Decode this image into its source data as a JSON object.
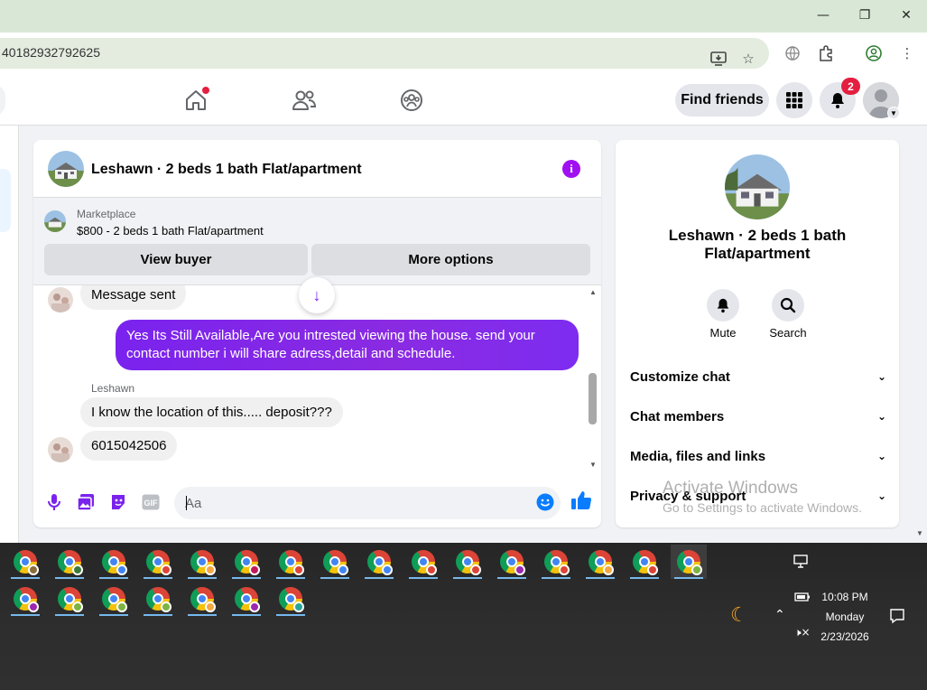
{
  "browser": {
    "url": "40182932792625",
    "window_controls": [
      "minimize",
      "restore",
      "close"
    ]
  },
  "nav": {
    "find_friends_label": "Find friends",
    "notification_count": "2",
    "icons": [
      "home-icon",
      "friends-icon",
      "groups-icon",
      "menu-grid-icon",
      "bell-icon",
      "account-avatar"
    ]
  },
  "chat": {
    "title": "Leshawn · 2 beds 1 bath Flat/apartment",
    "marketplace": {
      "label": "Marketplace",
      "price_line": "$800 - 2 beds 1 bath Flat/apartment",
      "view_buyer": "View buyer",
      "more_options": "More options"
    },
    "messages": [
      {
        "from": "Leshawn",
        "text": "Message sent"
      },
      {
        "from": "me",
        "text": "Yes Its Still Available,Are you intrested viewing the house. send your contact number i will share adress,detail and schedule."
      },
      {
        "from": "Leshawn",
        "sender_label": "Leshawn",
        "text": "I know the location of this..... deposit???"
      },
      {
        "from": "Leshawn",
        "text": "6015042506"
      }
    ],
    "composer_placeholder": "Aa",
    "colors": {
      "outgoing": "#7a23ee",
      "accent": "#a010f0"
    }
  },
  "details": {
    "name": "Leshawn · 2 beds 1 bath Flat/apartment",
    "actions": [
      {
        "label": "Mute"
      },
      {
        "label": "Search"
      }
    ],
    "sections": [
      {
        "label": "Customize chat"
      },
      {
        "label": "Chat members"
      },
      {
        "label": "Media, files and links"
      },
      {
        "label": "Privacy & support"
      }
    ]
  },
  "watermark": {
    "line1": "Activate Windows",
    "line2": "Go to Settings to activate Windows."
  },
  "taskbar": {
    "row1_profile_colors": [
      "#8a6d3b",
      "#3a7a3a",
      "#4285f4",
      "#db4437",
      "#f4a742",
      "#c2185b",
      "#db4437",
      "#4285f4",
      "#4285f4",
      "#db4437",
      "#db4437",
      "#9c27b0",
      "#db4437",
      "#f4a742",
      "#db4437",
      "#7cb342"
    ],
    "row2_profile_colors": [
      "#9c27b0",
      "#7cb342",
      "#7cb342",
      "#7cb342",
      "#f4a742",
      "#9c27b0",
      "#26a69a"
    ],
    "time": "10:08 PM",
    "day": "Monday",
    "date": "2/23/2026"
  }
}
